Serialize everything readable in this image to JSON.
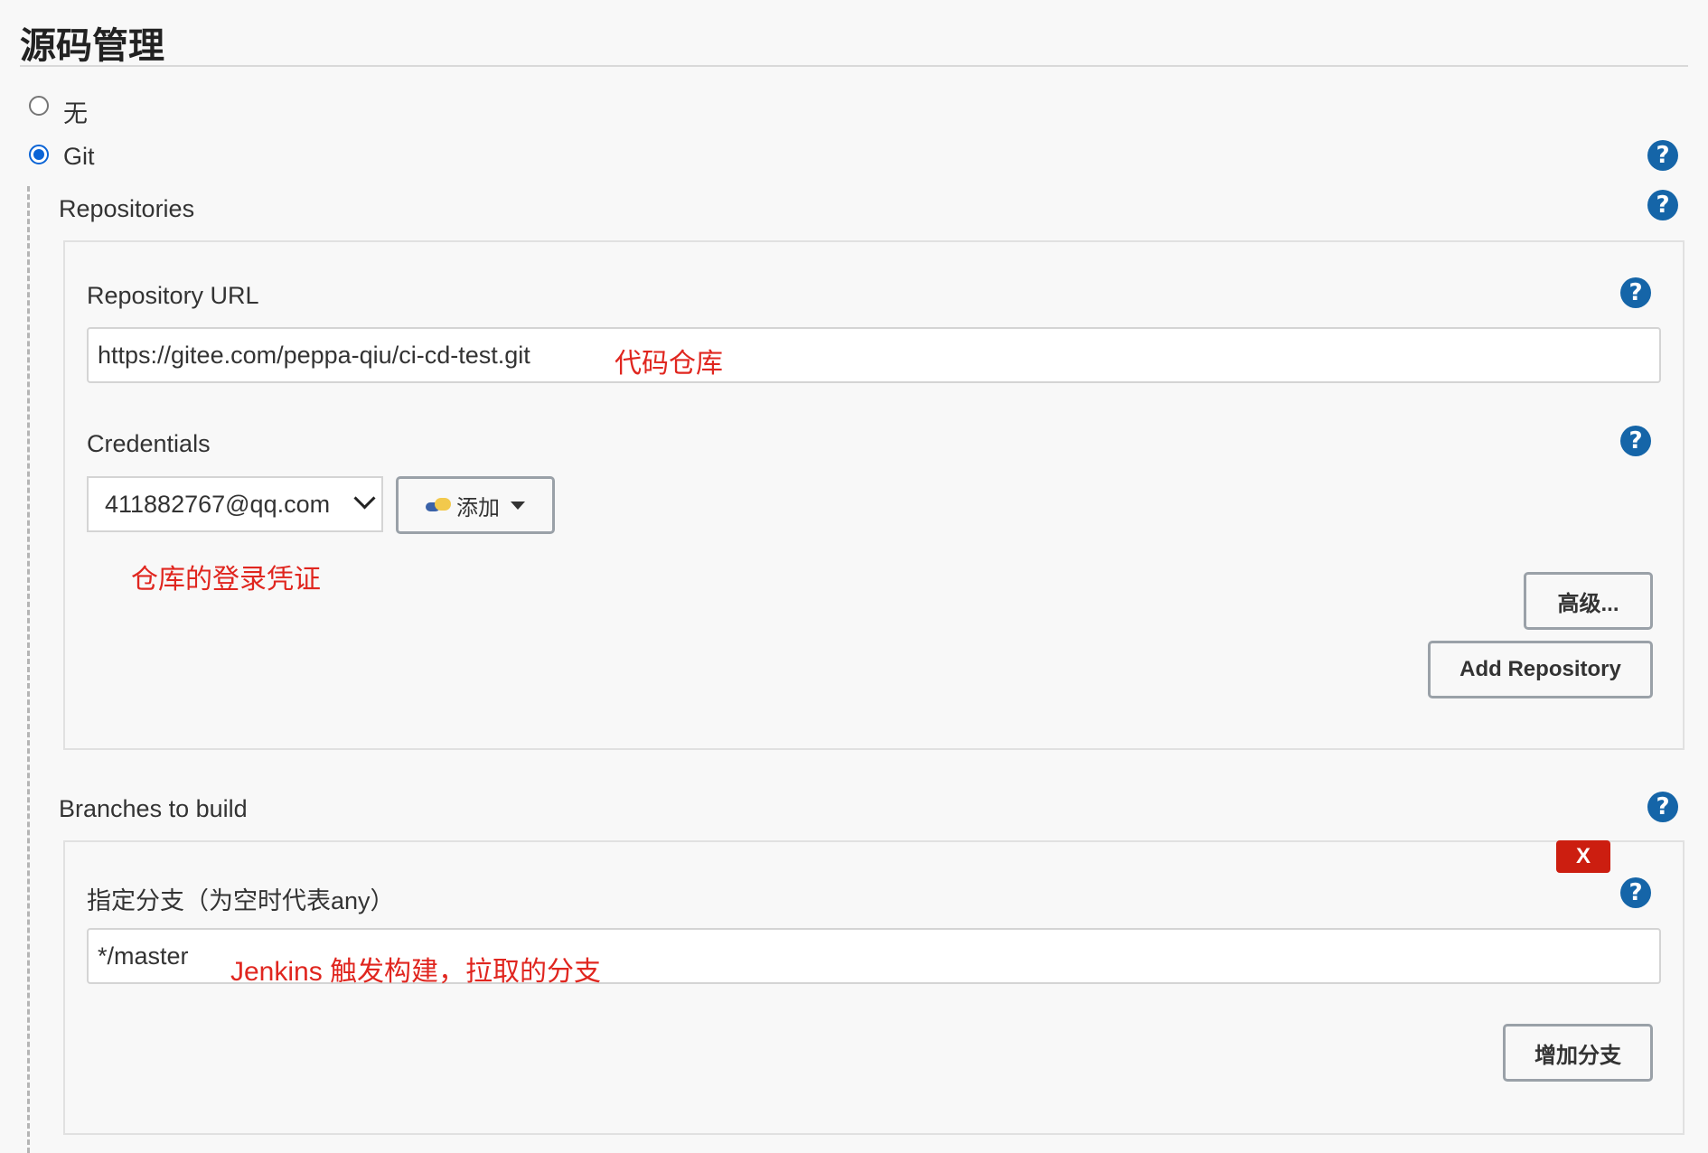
{
  "section": {
    "title": "源码管理"
  },
  "scm_options": [
    {
      "label": "无",
      "selected": false
    },
    {
      "label": "Git",
      "selected": true
    }
  ],
  "repositories": {
    "heading": "Repositories",
    "url_label": "Repository URL",
    "url_value": "https://gitee.com/peppa-qiu/ci-cd-test.git",
    "url_annotation": "代码仓库",
    "credentials_label": "Credentials",
    "credentials_value": "411882767@qq.com",
    "add_label": "添加",
    "credentials_annotation": "仓库的登录凭证",
    "advanced_label": "高级...",
    "add_repository_label": "Add Repository"
  },
  "branches": {
    "heading": "Branches to build",
    "delete_label": "X",
    "branch_label": "指定分支（为空时代表any）",
    "branch_value": "*/master",
    "branch_annotation": "Jenkins 触发构建，拉取的分支",
    "add_branch_label": "增加分支"
  },
  "help_icon_glyph": "?",
  "colors": {
    "accent": "#1565a8",
    "annotation": "#e0261f",
    "delete": "#cc1e10",
    "radio_selected": "#0a64d6"
  }
}
